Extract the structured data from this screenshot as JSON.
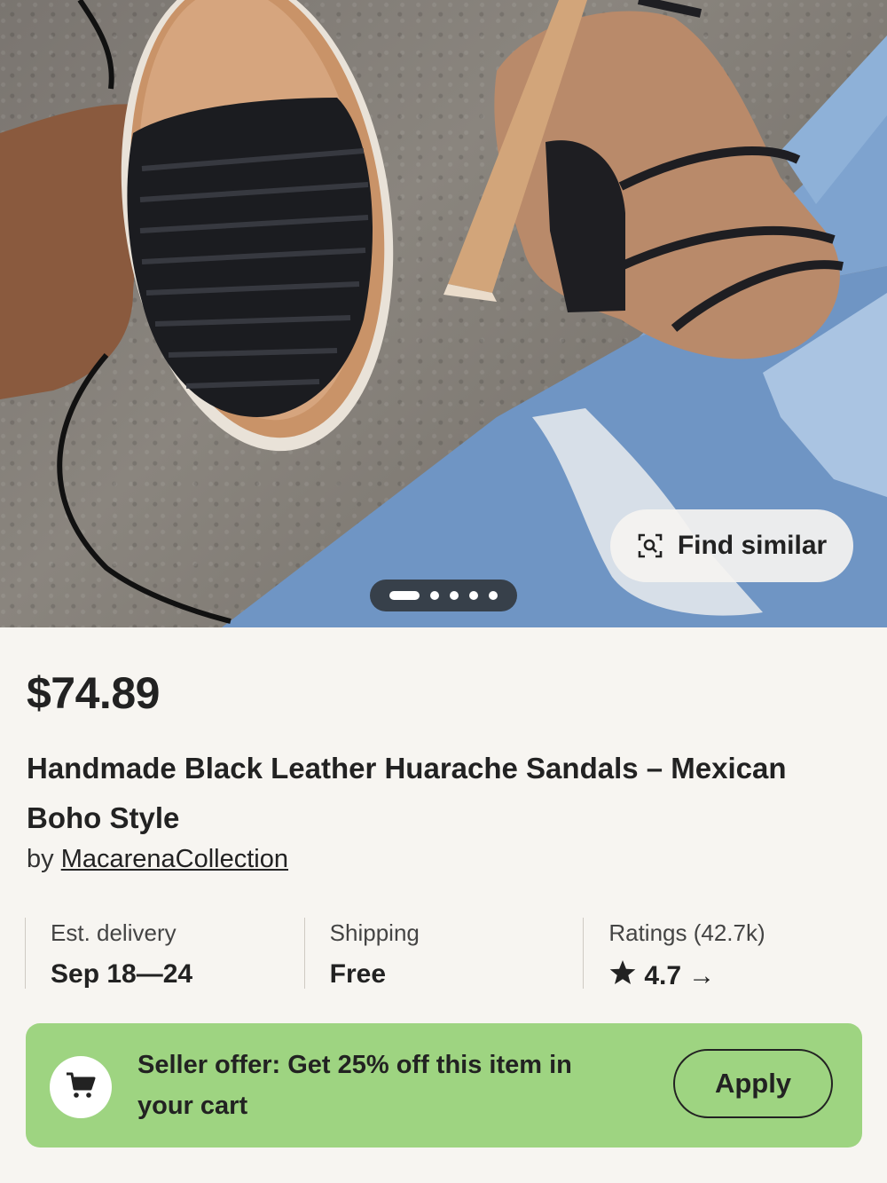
{
  "hero": {
    "find_similar_label": "Find similar",
    "carousel_total": 5,
    "carousel_active": 1
  },
  "product": {
    "price": "$74.89",
    "title": "Handmade Black Leather Huarache Sandals – Mexican Boho Style",
    "seller_prefix": "by",
    "seller_name": "MacarenaCollection"
  },
  "info": {
    "delivery_label": "Est. delivery",
    "delivery_value": "Sep 18—24",
    "shipping_label": "Shipping",
    "shipping_value": "Free",
    "ratings_label": "Ratings (42.7k)",
    "rating_value": "4.7",
    "rating_arrow": "→"
  },
  "offer": {
    "text": "Seller offer: Get 25% off this item in your cart",
    "apply_label": "Apply",
    "background_color": "#9ed481"
  },
  "icons": {
    "find_similar": "visual-search-icon",
    "cart": "cart-icon",
    "star": "star-icon"
  }
}
